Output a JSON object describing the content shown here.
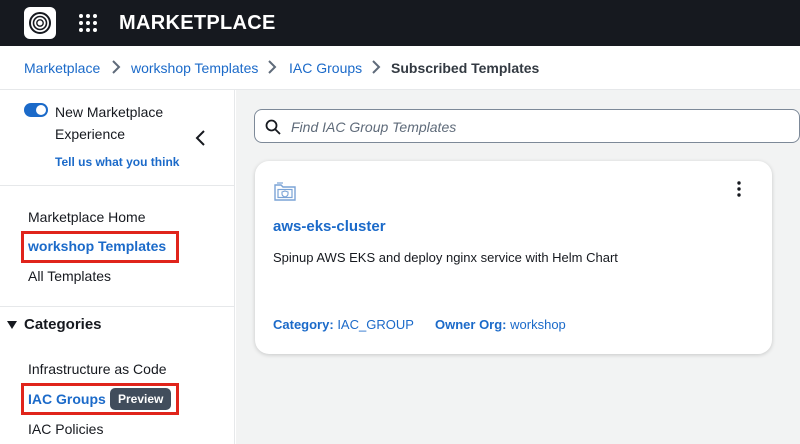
{
  "header": {
    "app_title": "MARKETPLACE",
    "logo_icon": "concentric-rings-logo-icon",
    "apps_icon": "grid-apps-icon"
  },
  "breadcrumb": {
    "items": [
      "Marketplace",
      "workshop Templates",
      "IAC Groups",
      "Subscribed Templates"
    ],
    "separator_icon": "chevron-right-icon"
  },
  "sidebar": {
    "toggle_on": true,
    "new_experience_line1": "New Marketplace",
    "new_experience_line2": "Experience",
    "feedback_link": "Tell us what you think",
    "nav_items": [
      "Marketplace Home",
      "workshop Templates",
      "All Templates"
    ],
    "categories_heading": "Categories",
    "category_items": [
      "Infrastructure as Code",
      "IAC Groups",
      "IAC Policies"
    ],
    "preview_badge": "Preview"
  },
  "search": {
    "placeholder": "Find IAC Group Templates",
    "value": ""
  },
  "card": {
    "title": "aws-eks-cluster",
    "description": "Spinup AWS EKS and deploy nginx service with Helm Chart",
    "category_label": "Category:",
    "category_value": "IAC_GROUP",
    "owner_label": "Owner Org:",
    "owner_value": "workshop"
  },
  "colors": {
    "topbar": "#16191f",
    "link": "#1b6ac9",
    "highlight_box": "#e0241b",
    "content_bg": "#f2f3f3",
    "badge_bg": "#414d5c"
  }
}
